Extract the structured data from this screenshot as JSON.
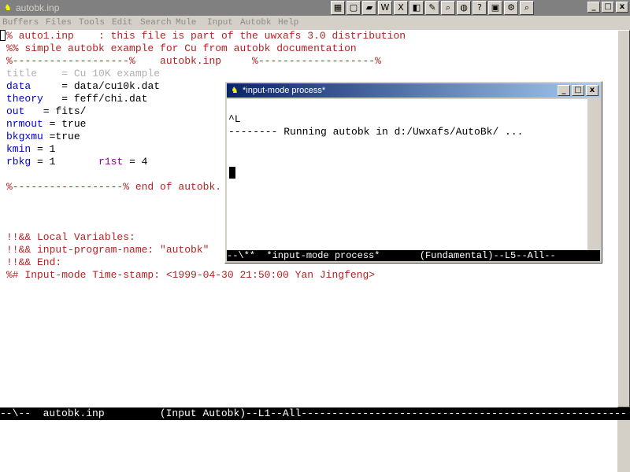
{
  "window": {
    "title": "autobk.inp",
    "app_icon": "gnu-icon",
    "minimize": "_",
    "maximize": "□",
    "close": "x"
  },
  "toolbar": {
    "icons": [
      "grid-icon",
      "new-file-icon",
      "open-folder-icon",
      "word-icon",
      "excel-icon",
      "browser-icon",
      "tools-icon",
      "search-icon",
      "globe-icon",
      "help-icon",
      "app-icon",
      "settings-icon",
      "magnifier-icon"
    ]
  },
  "menu": {
    "items": [
      "Buffers",
      "Files",
      "Tools",
      "Edit",
      "Search",
      "Mule",
      "Input",
      "Autobk",
      "Help"
    ]
  },
  "editor": {
    "lines": [
      {
        "text": "% auto1.inp    : this file is part of the uwxafs 3.0 distribution",
        "cls": "c-red"
      },
      {
        "text": "%% simple autobk example for Cu from autobk documentation",
        "cls": "c-red"
      },
      {
        "text": "%-------------------%    autobk.inp     %-------------------%",
        "cls": "c-red"
      },
      {
        "text": "title    = Cu 10K example",
        "cls": "c-gray"
      },
      {
        "text": "data",
        "cls": "c-kw",
        "rest": "     = data/cu10k.dat"
      },
      {
        "text": "theory",
        "cls": "c-kw",
        "rest": "   = feff/chi.dat"
      },
      {
        "text": "out",
        "cls": "c-kw",
        "rest": "   = fits/"
      },
      {
        "text": "nrmout",
        "cls": "c-kw",
        "rest": " = true"
      },
      {
        "text": "bkgxmu",
        "cls": "c-kw",
        "rest": " =true"
      },
      {
        "text": "kmin",
        "cls": "c-kw",
        "rest": " = 1"
      },
      {
        "text": "rbkg",
        "cls": "c-kw",
        "rest": " = 1       ",
        "kw2": "r1st",
        "rest2": " = 4"
      },
      {
        "text": "",
        "cls": "c-blk"
      },
      {
        "text": "%------------------% end of autobk.",
        "cls": "c-red"
      },
      {
        "text": "",
        "cls": "c-blk"
      },
      {
        "text": "",
        "cls": "c-blk"
      },
      {
        "text": "",
        "cls": "c-blk"
      },
      {
        "text": "!!&& Local Variables:",
        "cls": "c-red"
      },
      {
        "text": "!!&& input-program-name: \"autobk\"",
        "cls": "c-red"
      },
      {
        "text": "!!&& End:",
        "cls": "c-red"
      },
      {
        "text": "%# Input-mode Time-stamp: <1999-04-30 21:50:00 Yan Jingfeng>",
        "cls": "c-red"
      }
    ]
  },
  "modeline": "--\\--  autobk.inp         (Input Autobk)--L1--All-----------------------------------------------------",
  "subwindow": {
    "title": "*input-mode process*",
    "lines": [
      "^L",
      "-------- Running autobk in d:/Uwxafs/AutoBk/ ..."
    ],
    "modeline": "--\\**  *input-mode process*       (Fundamental)--L5--All--",
    "minimize": "_",
    "maximize": "□",
    "close": "x"
  }
}
